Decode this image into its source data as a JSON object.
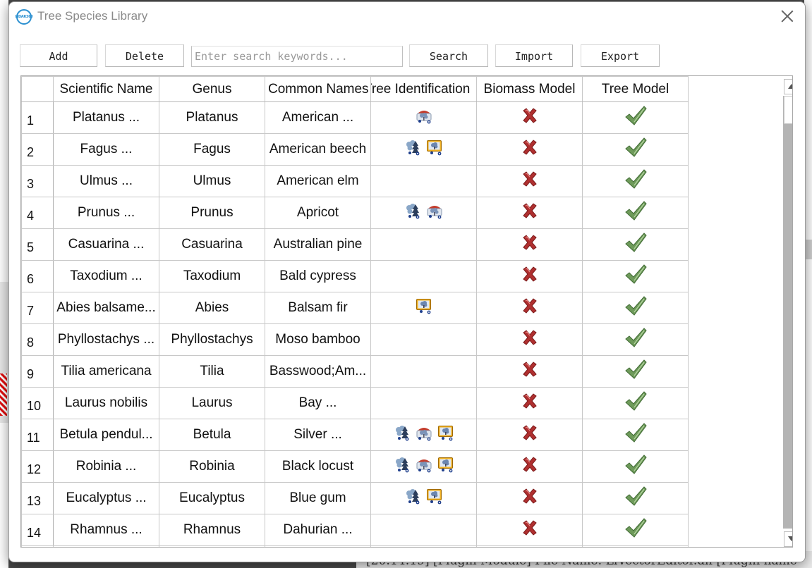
{
  "window": {
    "title": "Tree Species Library",
    "logo_text": "LIDAR360"
  },
  "toolbar": {
    "add_label": "Add",
    "delete_label": "Delete",
    "search_placeholder": "Enter search keywords...",
    "search_label": "Search",
    "import_label": "Import",
    "export_label": "Export"
  },
  "table": {
    "columns": [
      "Scientific Name",
      "Genus",
      "Common Names",
      "Tree Identification",
      "Biomass Model",
      "Tree Model"
    ],
    "rows": [
      {
        "no": "1",
        "sci": "Platanus ...",
        "genus": "Platanus",
        "common": "American ...",
        "ident": [
          "model-tree-icon"
        ],
        "biomass": false,
        "tree": true
      },
      {
        "no": "2",
        "sci": "Fagus ...",
        "genus": "Fagus",
        "common": "American beech",
        "ident": [
          "pointcloud-tree-icon",
          "monitor-tree-icon"
        ],
        "biomass": false,
        "tree": true
      },
      {
        "no": "3",
        "sci": "Ulmus ...",
        "genus": "Ulmus",
        "common": "American elm",
        "ident": [],
        "biomass": false,
        "tree": true
      },
      {
        "no": "4",
        "sci": "Prunus ...",
        "genus": "Prunus",
        "common": "Apricot",
        "ident": [
          "pointcloud-tree-icon",
          "model-tree-icon"
        ],
        "biomass": false,
        "tree": true
      },
      {
        "no": "5",
        "sci": "Casuarina ...",
        "genus": "Casuarina",
        "common": "Australian pine",
        "ident": [],
        "biomass": false,
        "tree": true
      },
      {
        "no": "6",
        "sci": "Taxodium ...",
        "genus": "Taxodium",
        "common": "Bald cypress",
        "ident": [],
        "biomass": false,
        "tree": true
      },
      {
        "no": "7",
        "sci": "Abies balsame...",
        "genus": "Abies",
        "common": "Balsam fir",
        "ident": [
          "monitor-tree-icon"
        ],
        "biomass": false,
        "tree": true
      },
      {
        "no": "8",
        "sci": "Phyllostachys ...",
        "genus": "Phyllostachys",
        "common": "Moso bamboo",
        "ident": [],
        "biomass": false,
        "tree": true
      },
      {
        "no": "9",
        "sci": "Tilia americana",
        "genus": "Tilia",
        "common": "Basswood;Am...",
        "ident": [],
        "biomass": false,
        "tree": true
      },
      {
        "no": "10",
        "sci": "Laurus nobilis",
        "genus": "Laurus",
        "common": "Bay ...",
        "ident": [],
        "biomass": false,
        "tree": true
      },
      {
        "no": "11",
        "sci": "Betula pendul...",
        "genus": "Betula",
        "common": "Silver ...",
        "ident": [
          "pointcloud-tree-icon",
          "model-tree-icon",
          "monitor-tree-icon"
        ],
        "biomass": false,
        "tree": true
      },
      {
        "no": "12",
        "sci": "Robinia ...",
        "genus": "Robinia",
        "common": "Black locust",
        "ident": [
          "pointcloud-tree-icon",
          "model-tree-icon",
          "monitor-tree-icon"
        ],
        "biomass": false,
        "tree": true
      },
      {
        "no": "13",
        "sci": "Eucalyptus ...",
        "genus": "Eucalyptus",
        "common": "Blue gum",
        "ident": [
          "pointcloud-tree-icon",
          "monitor-tree-icon"
        ],
        "biomass": false,
        "tree": true
      },
      {
        "no": "14",
        "sci": "Rhamnus ...",
        "genus": "Rhamnus",
        "common": "Dahurian ...",
        "ident": [],
        "biomass": false,
        "tree": true
      }
    ]
  },
  "background": {
    "status_text": "[20:14:19] [Plugin Module]    File Name: LiVectorEditor.dll    [Plugin name"
  },
  "colors": {
    "cross": "#b03030",
    "check": "#6e9a5a",
    "accent": "#2a8fd0"
  }
}
